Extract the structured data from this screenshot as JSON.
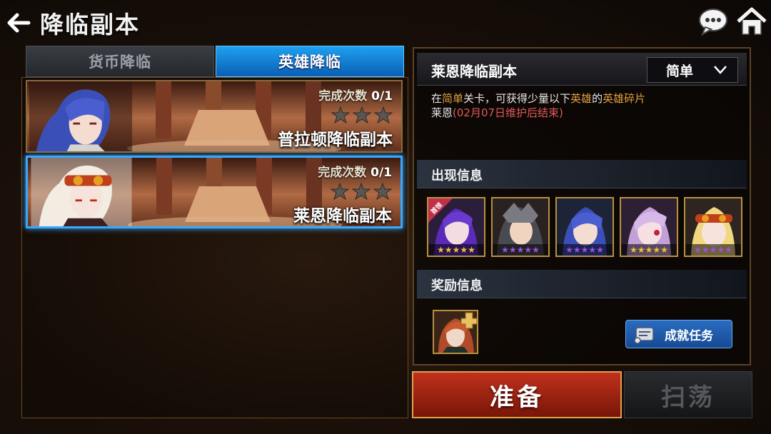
{
  "header": {
    "title": "降临副本",
    "back_icon": "back-arrow-icon",
    "chat_icon": "chat-bubble-icon",
    "home_icon": "home-icon"
  },
  "tabs": [
    {
      "label": "货币降临",
      "active": false
    },
    {
      "label": "英雄降临",
      "active": true
    }
  ],
  "dungeons": [
    {
      "name": "普拉顿降临副本",
      "count_label": "完成次数",
      "count": "0/1",
      "stars": 3,
      "selected": false
    },
    {
      "name": "莱恩降临副本",
      "count_label": "完成次数",
      "count": "0/1",
      "stars": 3,
      "selected": true
    }
  ],
  "detail": {
    "title": "莱恩降临副本",
    "difficulty": "简单",
    "desc_prefix": "在",
    "desc_hl1": "简单",
    "desc_mid": "关卡，可获得少量以下",
    "desc_hl2": "英雄",
    "desc_mid2": "的",
    "desc_hl3": "英雄碎片",
    "hero_name": "莱恩",
    "end_note": "(02月07日维护后结束)"
  },
  "appear": {
    "label": "出现信息",
    "first_badge": "首领",
    "heroes": [
      {
        "name": "hero-1",
        "star_color": "#f0c030",
        "stars": 5,
        "boss": true
      },
      {
        "name": "hero-2",
        "star_color": "#a050e0",
        "stars": 5,
        "boss": false
      },
      {
        "name": "hero-3",
        "star_color": "#a050e0",
        "stars": 5,
        "boss": false
      },
      {
        "name": "hero-4",
        "star_color": "#f0c030",
        "stars": 5,
        "boss": false
      },
      {
        "name": "hero-5",
        "star_color": "#a050e0",
        "stars": 5,
        "boss": false
      }
    ]
  },
  "reward": {
    "label": "奖励信息"
  },
  "buttons": {
    "achievement": "成就任务",
    "prepare": "准备",
    "sweep": "扫荡"
  },
  "colors": {
    "tab_active": "#1ea0f0",
    "prepare": "#c0311c",
    "highlight": "#e0a040",
    "end_note": "#e05a55"
  }
}
